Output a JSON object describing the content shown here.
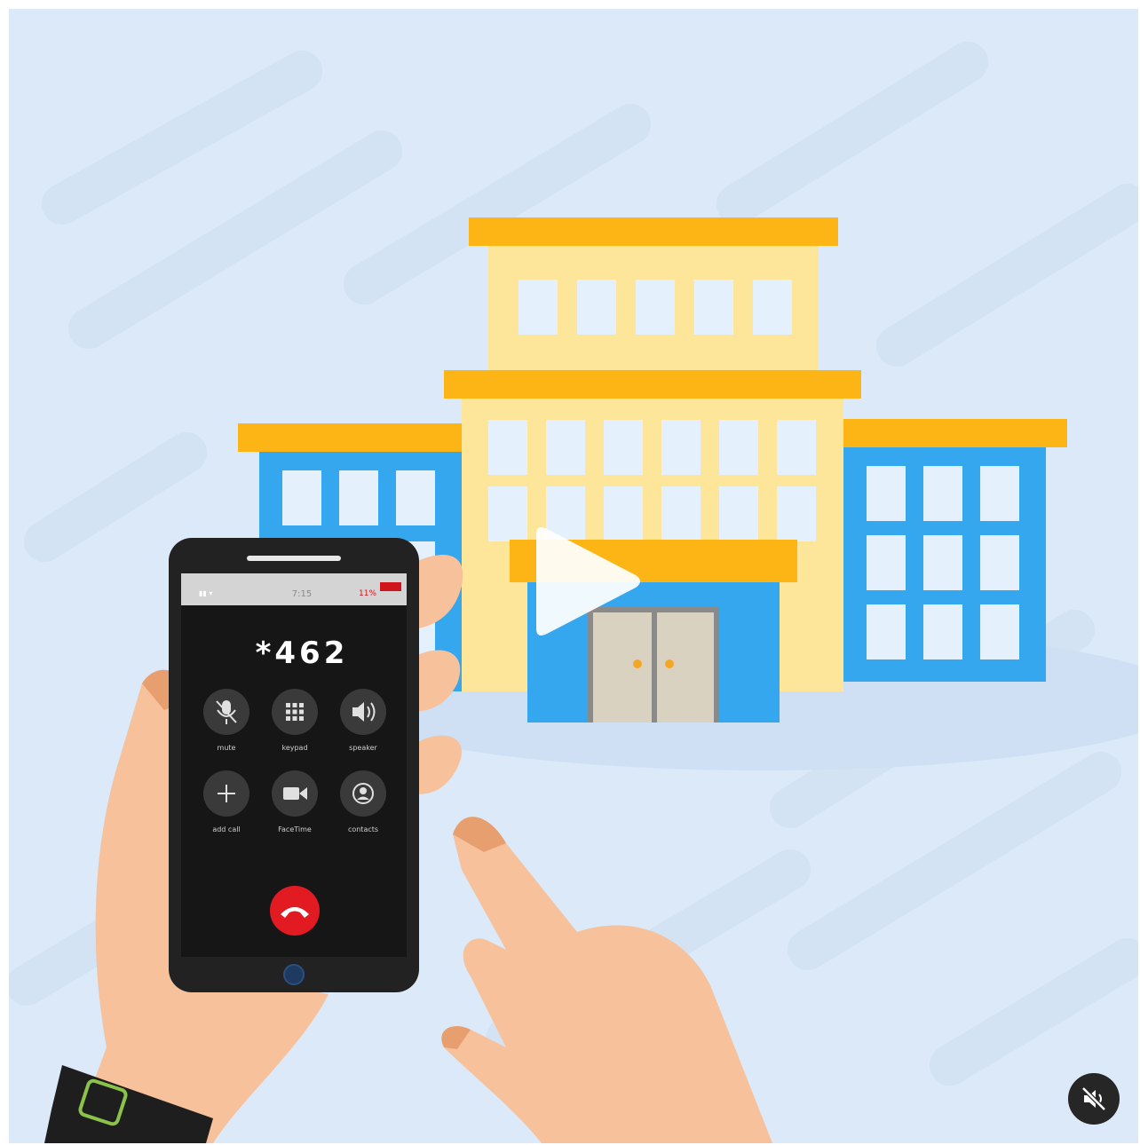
{
  "video": {
    "phone_screen": {
      "status_signal": "▮▮ ▾",
      "status_time": "7:15",
      "status_battery": "11%",
      "dialed_number": "*462",
      "buttons": [
        {
          "label": "mute",
          "icon": "mic-off-icon"
        },
        {
          "label": "keypad",
          "icon": "keypad-icon"
        },
        {
          "label": "speaker",
          "icon": "speaker-icon"
        },
        {
          "label": "add call",
          "icon": "plus-icon"
        },
        {
          "label": "FaceTime",
          "icon": "video-camera-icon"
        },
        {
          "label": "contacts",
          "icon": "contacts-icon"
        }
      ],
      "end_call_icon": "phone-hangup-icon"
    },
    "controls": {
      "play_icon": "play-icon",
      "mute_toggle_icon": "speaker-muted-icon"
    },
    "colors": {
      "background": "#dbe9f8",
      "building_yellow": "#fde59a",
      "roof_orange": "#fdb515",
      "building_blue": "#34a7ef",
      "window": "#e4f1fc",
      "phone_body": "#222222",
      "end_call_red": "#e21b23",
      "skin": "#f6c19b"
    }
  }
}
